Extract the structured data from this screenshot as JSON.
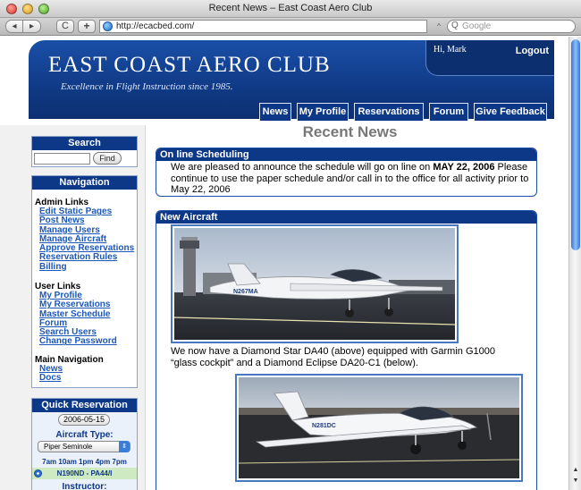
{
  "window": {
    "title": "Recent News – East Coast Aero Club"
  },
  "toolbar": {
    "back_glyph": "◂",
    "forward_glyph": "▸",
    "reload_glyph": "C",
    "add_glyph": "+",
    "url": "http://ecacbed.com/",
    "search_placeholder": "Google",
    "icons": [
      "back-icon",
      "forward-icon",
      "reload-icon",
      "add-bookmark-icon",
      "globe-icon",
      "search-icon"
    ]
  },
  "header": {
    "title": "EAST COAST AERO CLUB",
    "tagline": "Excellence in Flight Instruction since 1985.",
    "greeting": "Hi, Mark",
    "logout": "Logout",
    "brand_color": "#0d3787"
  },
  "nav": {
    "tabs": [
      "News",
      "My Profile",
      "Reservations",
      "Forum",
      "Give Feedback"
    ]
  },
  "sidebar": {
    "search": {
      "title": "Search",
      "button": "Find"
    },
    "navigation": {
      "title": "Navigation",
      "admin_title": "Admin Links",
      "admin_links": [
        "Edit Static Pages",
        "Post News",
        "Manage Users",
        "Manage Aircraft",
        "Approve Reservations",
        "Reservation Rules",
        "Billing"
      ],
      "user_title": "User Links",
      "user_links": [
        "My Profile",
        "My Reservations",
        "Master Schedule",
        "Forum",
        "Search Users",
        "Change Password"
      ],
      "main_title": "Main Navigation",
      "main_links": [
        "News",
        "Docs"
      ]
    },
    "quick_reservation": {
      "title": "Quick Reservation",
      "date": "2006-05-15",
      "aircraft_type_label": "Aircraft Type:",
      "aircraft_type": "Piper Seminole",
      "times": "7am 10am 1pm 4pm 7pm",
      "aircraft": "N190ND - PA44/I",
      "instructor_label": "Instructor:"
    }
  },
  "main": {
    "page_title": "Recent News",
    "news": [
      {
        "title": "On line Scheduling",
        "body_before": "We are pleased to announce the schedule will go on line on ",
        "body_bold": "MAY 22, 2006",
        "body_after": " Please continue to use the paper schedule and/or call in to the office for all activity prior to May 22, 2006"
      },
      {
        "title": "New Aircraft",
        "body": "We now have a Diamond Star DA40 (above) equipped with Garmin G1000 “glass cockpit” and a Diamond Eclipse DA20-C1 (below).",
        "photo1_tail": "N267MA",
        "photo2_tail": "N281DC"
      }
    ]
  },
  "scrollbar": {
    "up_glyph": "▲",
    "down_glyph": "▼"
  }
}
